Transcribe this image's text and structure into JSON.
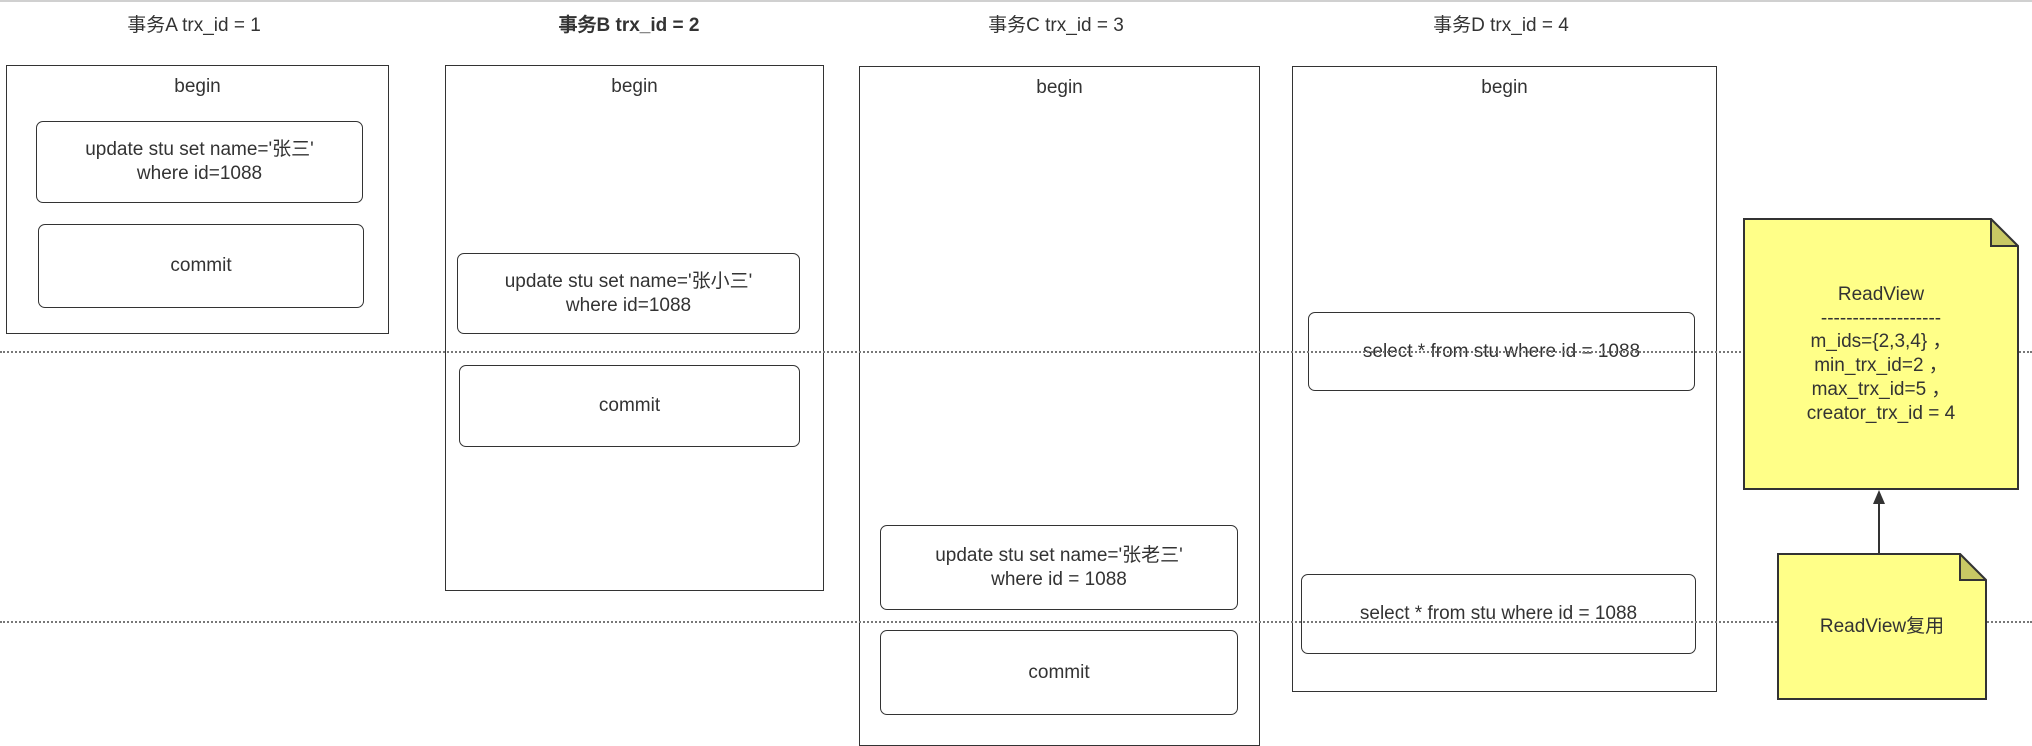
{
  "transactions": [
    {
      "title": "事务A trx_id = 1",
      "begin": "begin",
      "steps": [
        "update stu set name='张三'\nwhere id=1088",
        "commit"
      ]
    },
    {
      "title": "事务B trx_id = 2",
      "begin": "begin",
      "steps": [
        "update stu set name='张小三'\nwhere id=1088",
        "commit"
      ]
    },
    {
      "title": "事务C trx_id = 3",
      "begin": "begin",
      "steps": [
        "update stu set name='张老三'\nwhere id = 1088",
        "commit"
      ]
    },
    {
      "title": "事务D trx_id = 4",
      "begin": "begin",
      "steps": [
        "select * from stu where id = 1088",
        "select * from stu where id = 1088"
      ]
    }
  ],
  "readview": {
    "title": "ReadView",
    "separator": "-------------------",
    "lines": [
      "m_ids={2,3,4} ，",
      "min_trx_id=2 ，",
      "max_trx_id=5 ，",
      "creator_trx_id = 4"
    ]
  },
  "reuse_note": "ReadView复用",
  "colors": {
    "note_fill": "#ffff88",
    "note_fold": "#c8c864",
    "stroke": "#333333"
  }
}
